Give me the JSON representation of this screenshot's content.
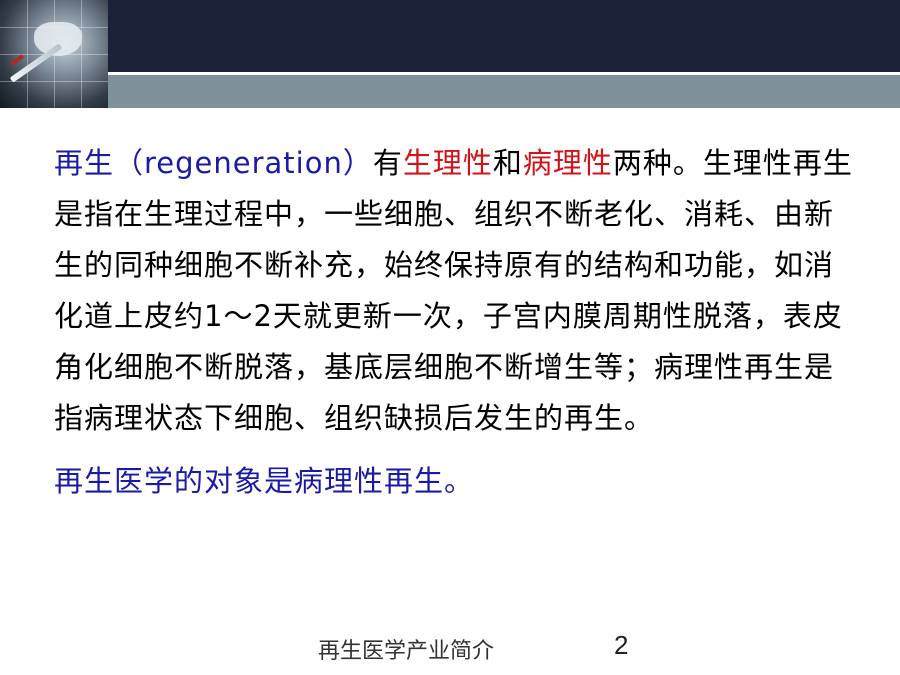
{
  "colors": {
    "header_dark": "#1b2238",
    "header_gray": "#7f919b",
    "blue_text": "#1a1aa6",
    "red_text": "#d4121a"
  },
  "header": {
    "image_icon": "medical-researcher-photo-icon"
  },
  "body": {
    "para1": {
      "term": "再生（regeneration）",
      "seg1": "有",
      "red1": "生理性",
      "seg2": "和",
      "red2": "病理性",
      "rest": "两种。生理性再生是指在生理过程中，一些细胞、组织不断老化、消耗、由新生的同种细胞不断补充，始终保持原有的结构和功能，如消化道上皮约1～2天就更新一次，子宫内膜周期性脱落，表皮角化细胞不断脱落，基底层细胞不断增生等；病理性再生是指病理状态下细胞、组织缺损后发生的再生。"
    },
    "para2": "再生医学的对象是病理性再生。"
  },
  "footer": {
    "title": "再生医学产业简介",
    "page_number": "2"
  }
}
